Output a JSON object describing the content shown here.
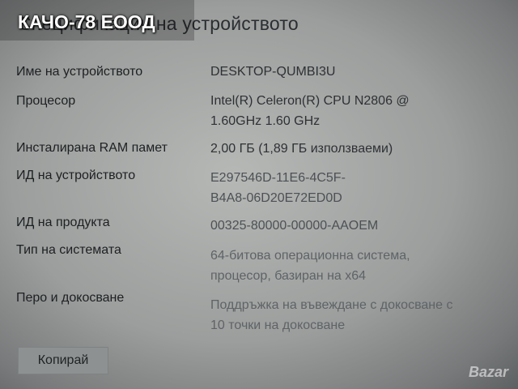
{
  "watermark": "КАЧО-78 ЕООД",
  "section_title": "Спецификации на устройството",
  "specs": [
    {
      "label": "Име на устройството",
      "value_lines": [
        "DESKTOP-QUMBI3U"
      ]
    },
    {
      "label": "Процесор",
      "value_lines": [
        "Intel(R) Celeron(R) CPU  N2806  @",
        "1.60GHz   1.60 GHz"
      ]
    },
    {
      "label": "Инсталирана RAM памет",
      "value_lines": [
        "2,00 ГБ (1,89 ГБ използваеми)"
      ]
    },
    {
      "label": "ИД на устройството",
      "value_lines": [
        "E297546D-11E6-4C5F-",
        "B4A8-06D20E72ED0D"
      ]
    },
    {
      "label": "ИД на продукта",
      "value_lines": [
        "00325-80000-00000-AAOEM"
      ]
    },
    {
      "label": "Тип на системата",
      "value_lines": [
        "64-битова операционна система,",
        "процесор, базиран на x64"
      ]
    },
    {
      "label": "Перо и докосване",
      "value_lines": [
        "Поддръжка на въвеждане с докосване с",
        "10 точки на докосване"
      ]
    }
  ],
  "copy_button_label": "Копирай",
  "logo": "Bazar"
}
